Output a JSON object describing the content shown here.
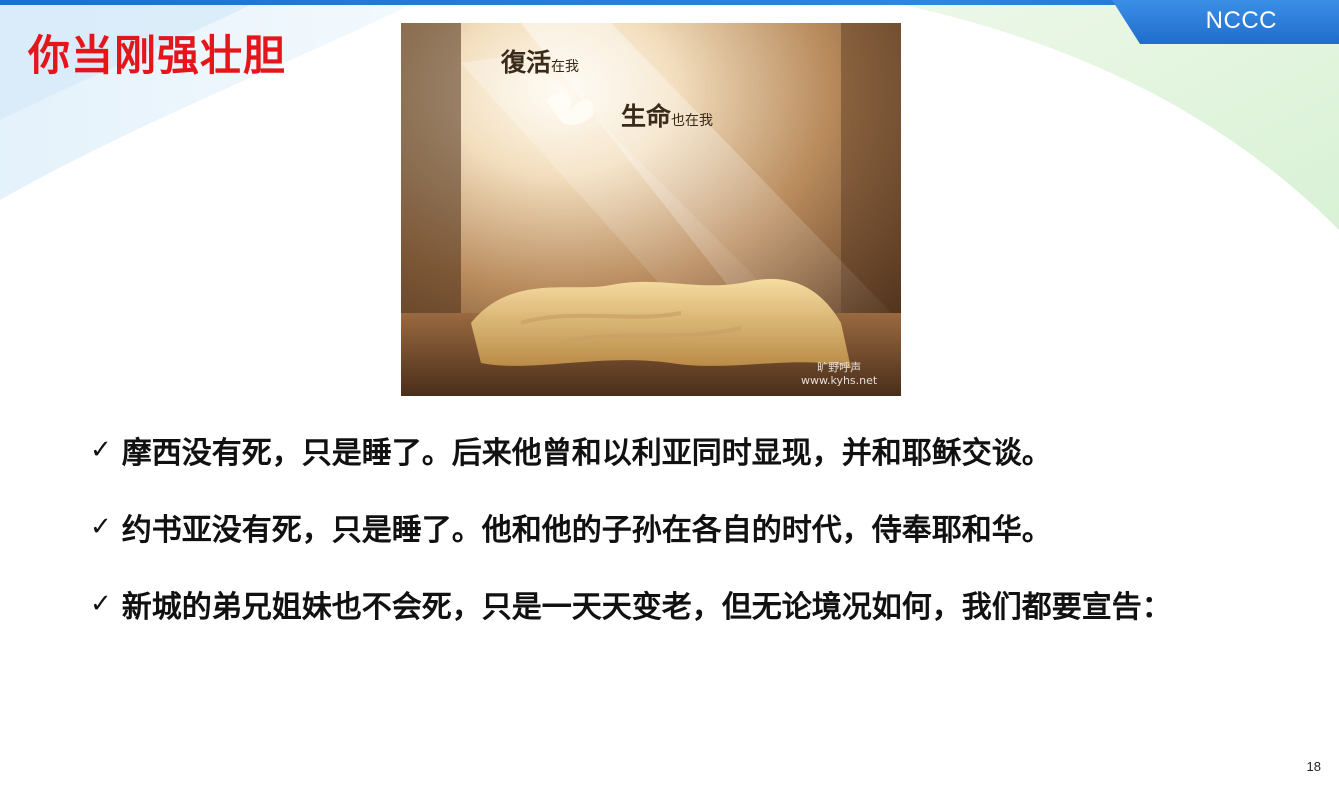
{
  "brand": "NCCC",
  "title": "你当刚强壮胆",
  "image": {
    "caption_line1_main": "復活",
    "caption_line1_small": "在我",
    "caption_line2_main": "生命",
    "caption_line2_small": "也在我",
    "watermark_name": "旷野呼声",
    "watermark_url": "www.kyhs.net"
  },
  "bullets": [
    {
      "check": "✓",
      "text": "摩西没有死，只是睡了。后来他曾和以利亚同时显现，并和耶稣交谈。"
    },
    {
      "check": "✓",
      "text": "约书亚没有死，只是睡了。他和他的子孙在各自的时代，侍奉耶和华。"
    },
    {
      "check": "✓",
      "text": "新城的弟兄姐妹也不会死，只是一天天变老，但无论境况如何，我们都要宣告："
    }
  ],
  "page_number": "18",
  "colors": {
    "title": "#e4161b",
    "brand_tab": "#2a7bd8",
    "text": "#111111"
  }
}
